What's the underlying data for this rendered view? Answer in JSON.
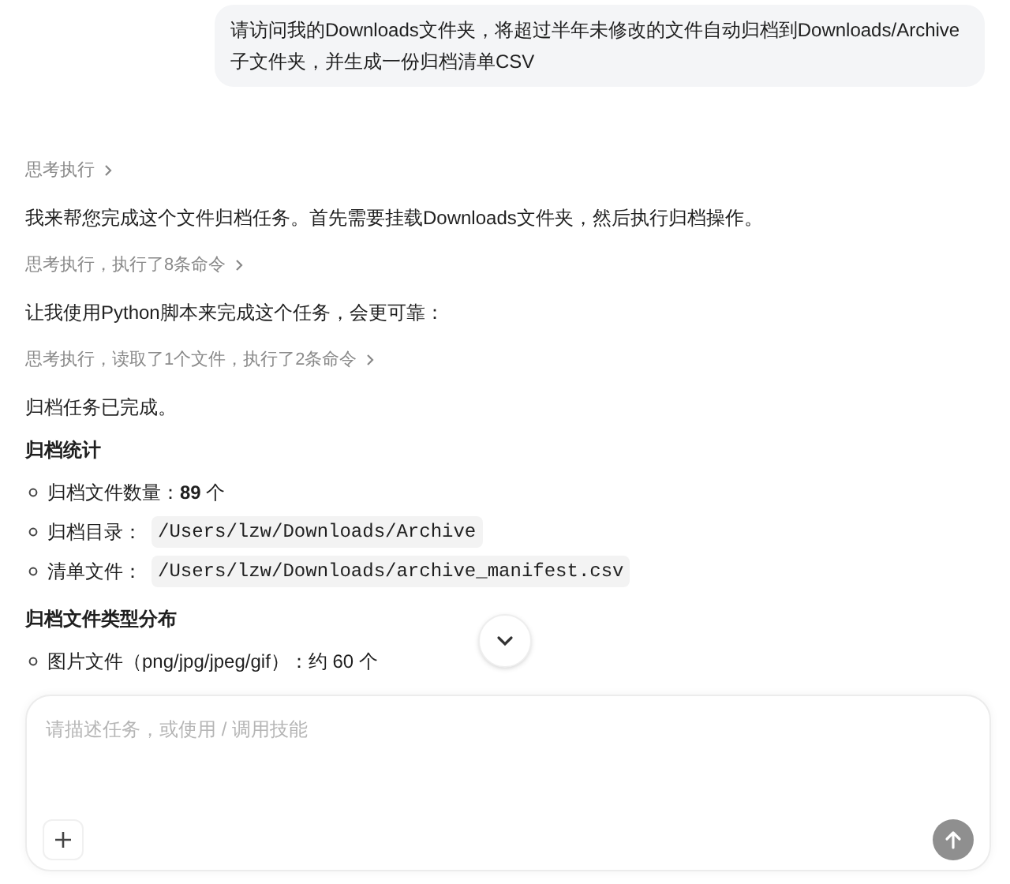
{
  "user_message": "请访问我的Downloads文件夹，将超过半年未修改的文件自动归档到Downloads/Archive子文件夹，并生成一份归档清单CSV",
  "blocks": [
    {
      "kind": "thinking",
      "text": "思考执行"
    },
    {
      "kind": "paragraph",
      "text": "我来帮您完成这个文件归档任务。首先需要挂载Downloads文件夹，然后执行归档操作。"
    },
    {
      "kind": "thinking",
      "text": "思考执行，执行了8条命令"
    },
    {
      "kind": "paragraph",
      "text": "让我使用Python脚本来完成这个任务，会更可靠："
    },
    {
      "kind": "thinking",
      "text": "思考执行，读取了1个文件，执行了2条命令"
    },
    {
      "kind": "paragraph",
      "text": "归档任务已完成。"
    },
    {
      "kind": "heading",
      "text": "归档统计"
    },
    {
      "kind": "list",
      "items": [
        {
          "text": "归档文件数量：**89** 个"
        },
        {
          "text": "归档目录：",
          "code": "/Users/lzw/Downloads/Archive"
        },
        {
          "text": "清单文件：",
          "code": "/Users/lzw/Downloads/archive_manifest.csv"
        }
      ]
    },
    {
      "kind": "heading",
      "text": "归档文件类型分布"
    },
    {
      "kind": "list",
      "items": [
        {
          "text": "图片文件（png/jpg/jpeg/gif）：约 60 个"
        }
      ]
    }
  ],
  "composer": {
    "placeholder": "请描述任务，或使用 / 调用技能"
  }
}
